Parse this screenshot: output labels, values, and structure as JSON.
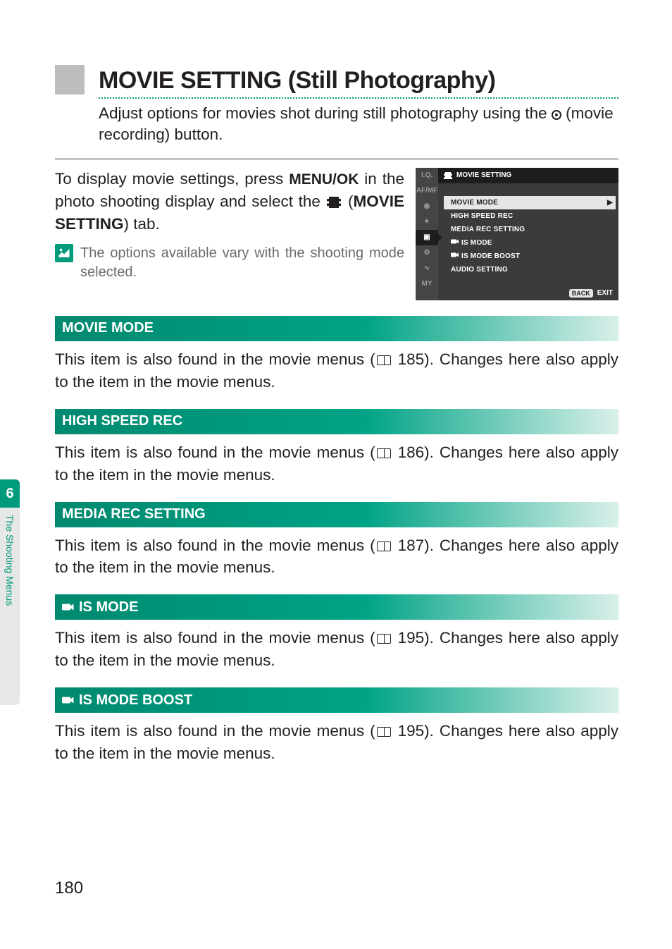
{
  "side_tab": {
    "chapter": "6",
    "title": "The Shooting Menus"
  },
  "title": "MOVIE SETTING (Still Photography)",
  "intro_a": "Adjust options for movies shot during still photography using the ",
  "intro_b": " (movie recording) button.",
  "instruct_a": "To display movie settings, press ",
  "instruct_menu": "MENU/OK",
  "instruct_b": " in the photo shooting display and select the ",
  "instruct_tab": "MOVIE SETTING",
  "instruct_c": ") tab.",
  "note": "The options available vary with the shooting mode selected.",
  "cam_menu": {
    "header": "MOVIE SETTING",
    "tabs": [
      "I.Q.",
      "AF/MF",
      "◉",
      "✦",
      "▣",
      "⚙",
      "∿",
      "MY"
    ],
    "active_tab_index": 4,
    "items": [
      "MOVIE MODE",
      "HIGH SPEED REC",
      "MEDIA REC SETTING",
      "IS MODE",
      "IS MODE BOOST",
      "AUDIO SETTING"
    ],
    "selected_index": 0,
    "back": "BACK",
    "exit": "EXIT"
  },
  "sections": [
    {
      "title": "MOVIE MODE",
      "icon": "",
      "page": "185"
    },
    {
      "title": "HIGH SPEED REC",
      "icon": "",
      "page": "186"
    },
    {
      "title": "MEDIA REC SETTING",
      "icon": "",
      "page": "187"
    },
    {
      "title": "IS MODE",
      "icon": "cam",
      "page": "195"
    },
    {
      "title": "IS MODE BOOST",
      "icon": "cam",
      "page": "195"
    }
  ],
  "section_body_a": "This item is also found in the movie menus (",
  "section_body_b": "). Changes here also apply to the item in the movie menus.",
  "page_number": "180"
}
